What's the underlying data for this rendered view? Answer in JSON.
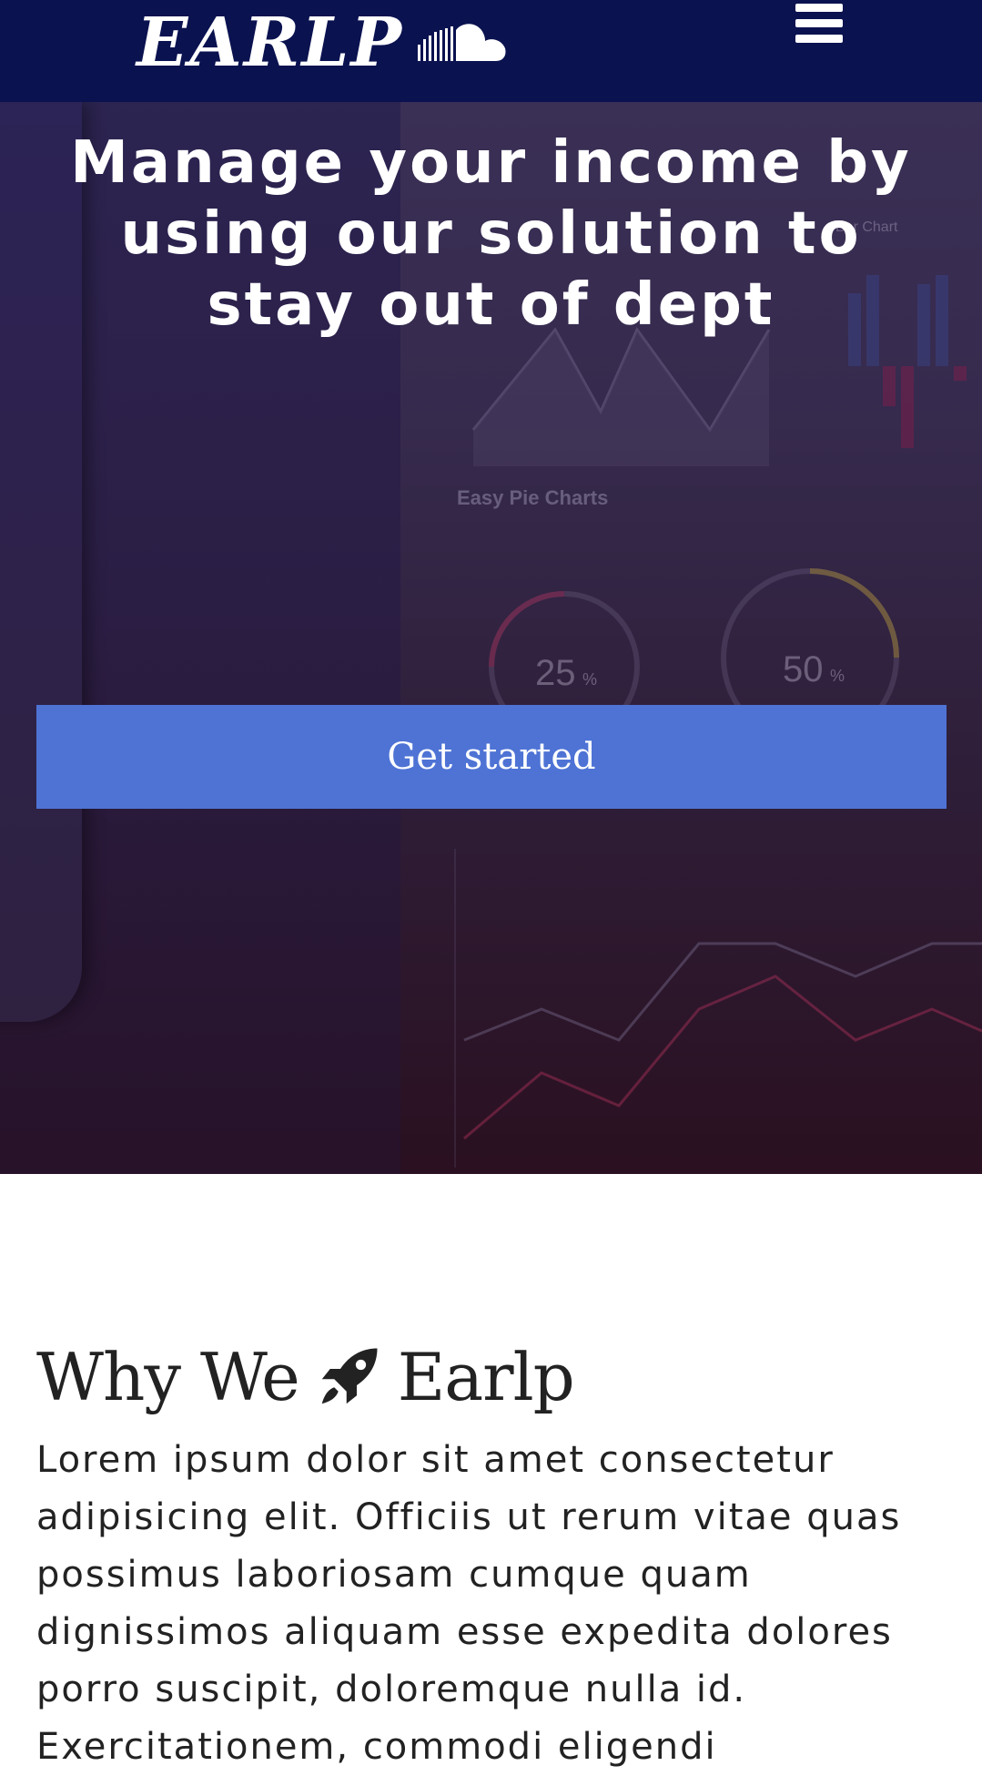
{
  "navbar": {
    "brand": "EARLP",
    "brand_icon": "soundcloud-icon",
    "menu_icon": "hamburger-menu-icon",
    "background": "#0a1250"
  },
  "hero": {
    "headline": "Manage your income by using our solution to stay out of dept",
    "cta_label": "Get started",
    "cta_color": "#4e73d5",
    "background_labels": {
      "pie_heading": "Easy Pie Charts",
      "bar_heading": "Bar Chart",
      "pie_value_1": "25",
      "pie_value_2": "50",
      "percent": "%"
    }
  },
  "why": {
    "title_before": "Why We",
    "title_icon": "rocket-icon",
    "title_after": "Earlp",
    "body": "Lorem ipsum dolor sit amet consectetur adipisicing elit. Officiis ut rerum vitae quas possimus laboriosam cumque quam dignissimos aliquam esse expedita dolores porro suscipit, doloremque nulla id. Exercitationem, commodi eligendi"
  }
}
